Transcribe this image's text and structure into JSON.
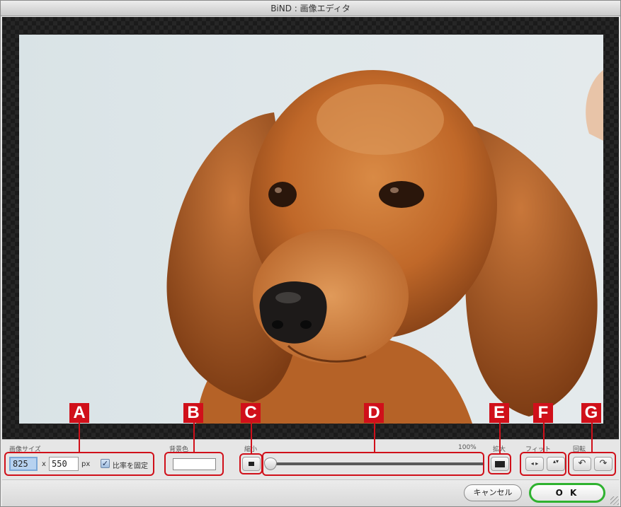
{
  "window": {
    "title": "BiND : 画像エディタ"
  },
  "image_size": {
    "label": "画像サイズ",
    "width": "825",
    "height": "550",
    "x_sep": "x",
    "unit": "px",
    "lock_label": "比率を固定",
    "lock_checked": true,
    "check_glyph": "✓"
  },
  "background": {
    "label": "背景色",
    "color": "#ffffff"
  },
  "zoom": {
    "shrink_label": "縮小",
    "enlarge_label": "拡大",
    "percent": "100%",
    "slider_fraction": 0.0
  },
  "fit": {
    "label": "フィット",
    "horizontal_icon": "◂ ▸",
    "vertical_icon": "▴▾"
  },
  "rotate": {
    "label": "回転",
    "left_icon": "↶",
    "right_icon": "↷"
  },
  "annotations": {
    "a": "A",
    "b": "B",
    "c": "C",
    "d": "D",
    "e": "E",
    "f": "F",
    "g": "G"
  },
  "buttons": {
    "cancel": "キャンセル",
    "ok": "O K"
  },
  "colors": {
    "accent_red": "#d0101a",
    "ok_border": "#2fb230",
    "dog_fur": "#c26a2c"
  }
}
